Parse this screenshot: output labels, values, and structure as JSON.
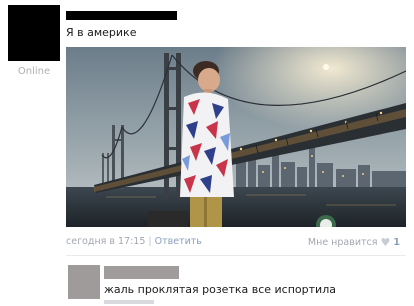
{
  "post": {
    "author_status": "Online",
    "text": "Я в америке",
    "timestamp": "сегодня в 17:15",
    "reply_label": "Ответить",
    "like_label": "Мне нравится",
    "like_count": "1"
  },
  "comment": {
    "text": "жаль проклятая розетка все испортила"
  },
  "colors": {
    "link": "#8aa0bb",
    "meta": "#a2a8b0",
    "redacted": "#000000",
    "comment_redacted": "#a09c9c"
  }
}
